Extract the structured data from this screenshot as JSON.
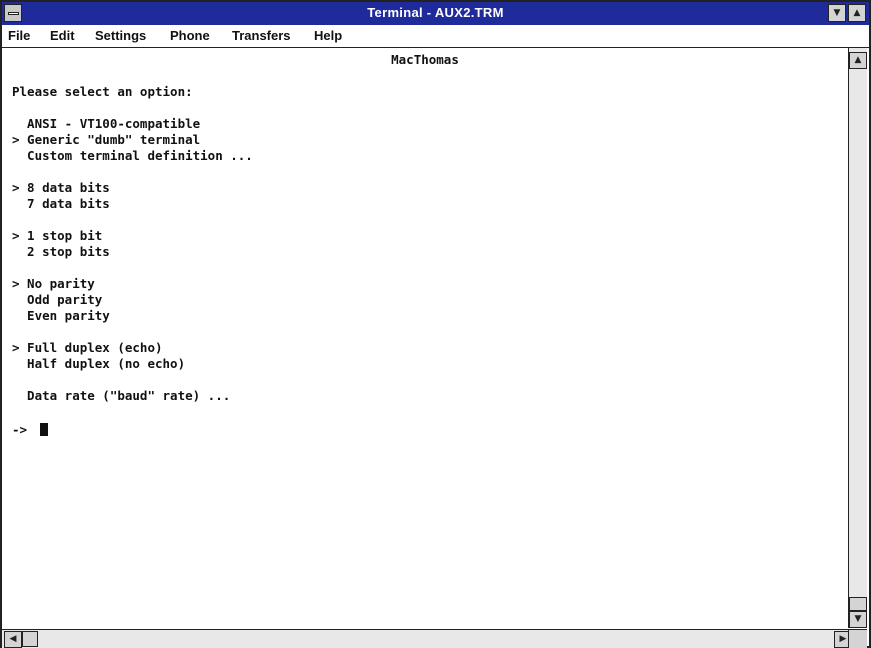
{
  "window": {
    "title": "Terminal - AUX2.TRM",
    "minimize_glyph": "▼",
    "maximize_glyph": "▲"
  },
  "menubar": {
    "items": [
      "File",
      "Edit",
      "Settings",
      "Phone",
      "Transfers",
      "Help"
    ]
  },
  "terminal": {
    "header": "MacThomas",
    "prompt_title": "Please select an option:",
    "lines": [
      "  ANSI - VT100-compatible",
      "> Generic \"dumb\" terminal",
      "  Custom terminal definition ...",
      "> 8 data bits",
      "  7 data bits",
      "> 1 stop bit",
      "  2 stop bits",
      "> No parity",
      "  Odd parity",
      "  Even parity",
      "> Full duplex (echo)",
      "  Half duplex (no echo)",
      "  Data rate (\"baud\" rate) ..."
    ],
    "command_prompt": "->"
  },
  "scrollbars": {
    "up_glyph": "▲",
    "down_glyph": "▼",
    "left_glyph": "◀",
    "right_glyph": "▶"
  }
}
